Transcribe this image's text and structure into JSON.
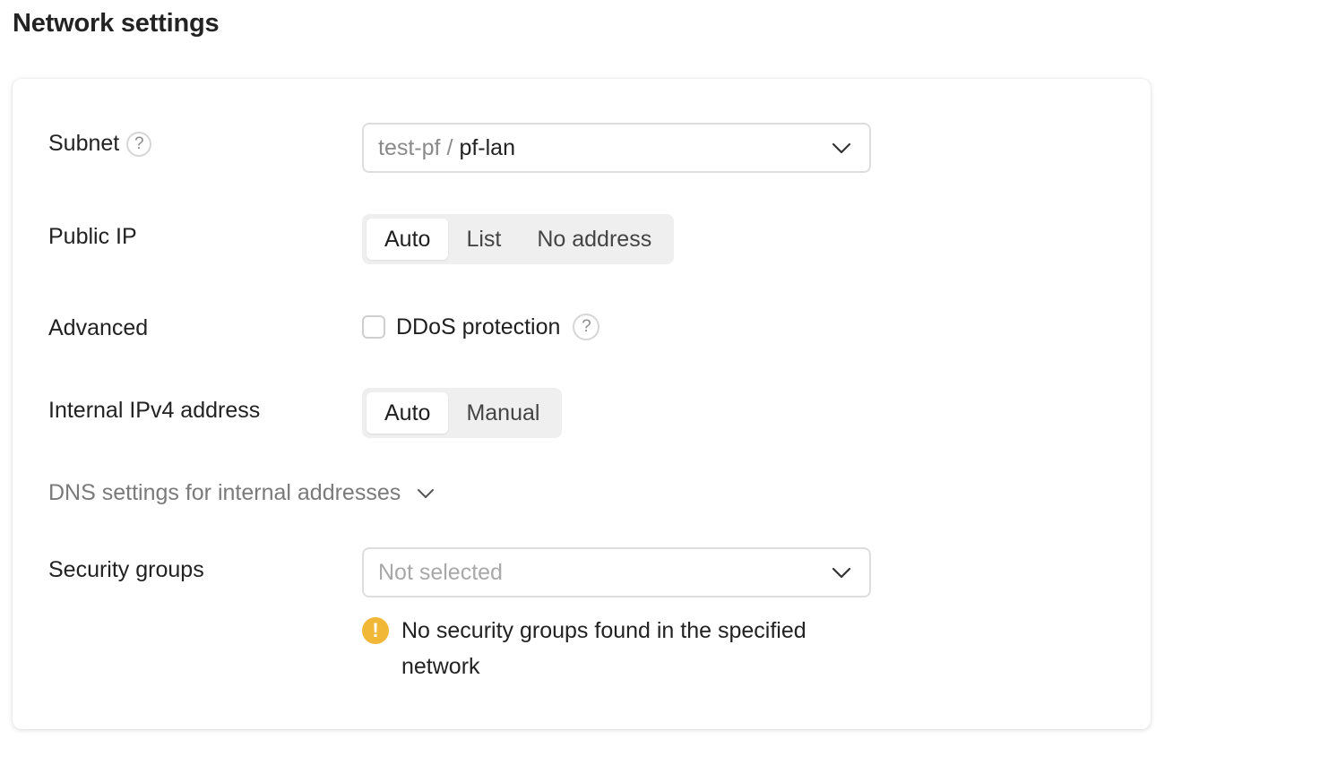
{
  "page_title": "Network settings",
  "subnet": {
    "label": "Subnet",
    "help": "?",
    "prefix": "test-pf",
    "separator": "/",
    "value": "pf-lan"
  },
  "public_ip": {
    "label": "Public IP",
    "options": [
      "Auto",
      "List",
      "No address"
    ],
    "selected": "Auto"
  },
  "advanced": {
    "label": "Advanced",
    "ddos_label": "DDoS protection",
    "ddos_checked": false,
    "help": "?"
  },
  "internal_ipv4": {
    "label": "Internal IPv4 address",
    "options": [
      "Auto",
      "Manual"
    ],
    "selected": "Auto"
  },
  "dns": {
    "label": "DNS settings for internal addresses"
  },
  "security_groups": {
    "label": "Security groups",
    "placeholder": "Not selected",
    "warning": "No security groups found in the specified network",
    "warning_icon": "!"
  },
  "colors": {
    "warning": "#f1b838",
    "segment_bg": "#efefef"
  }
}
